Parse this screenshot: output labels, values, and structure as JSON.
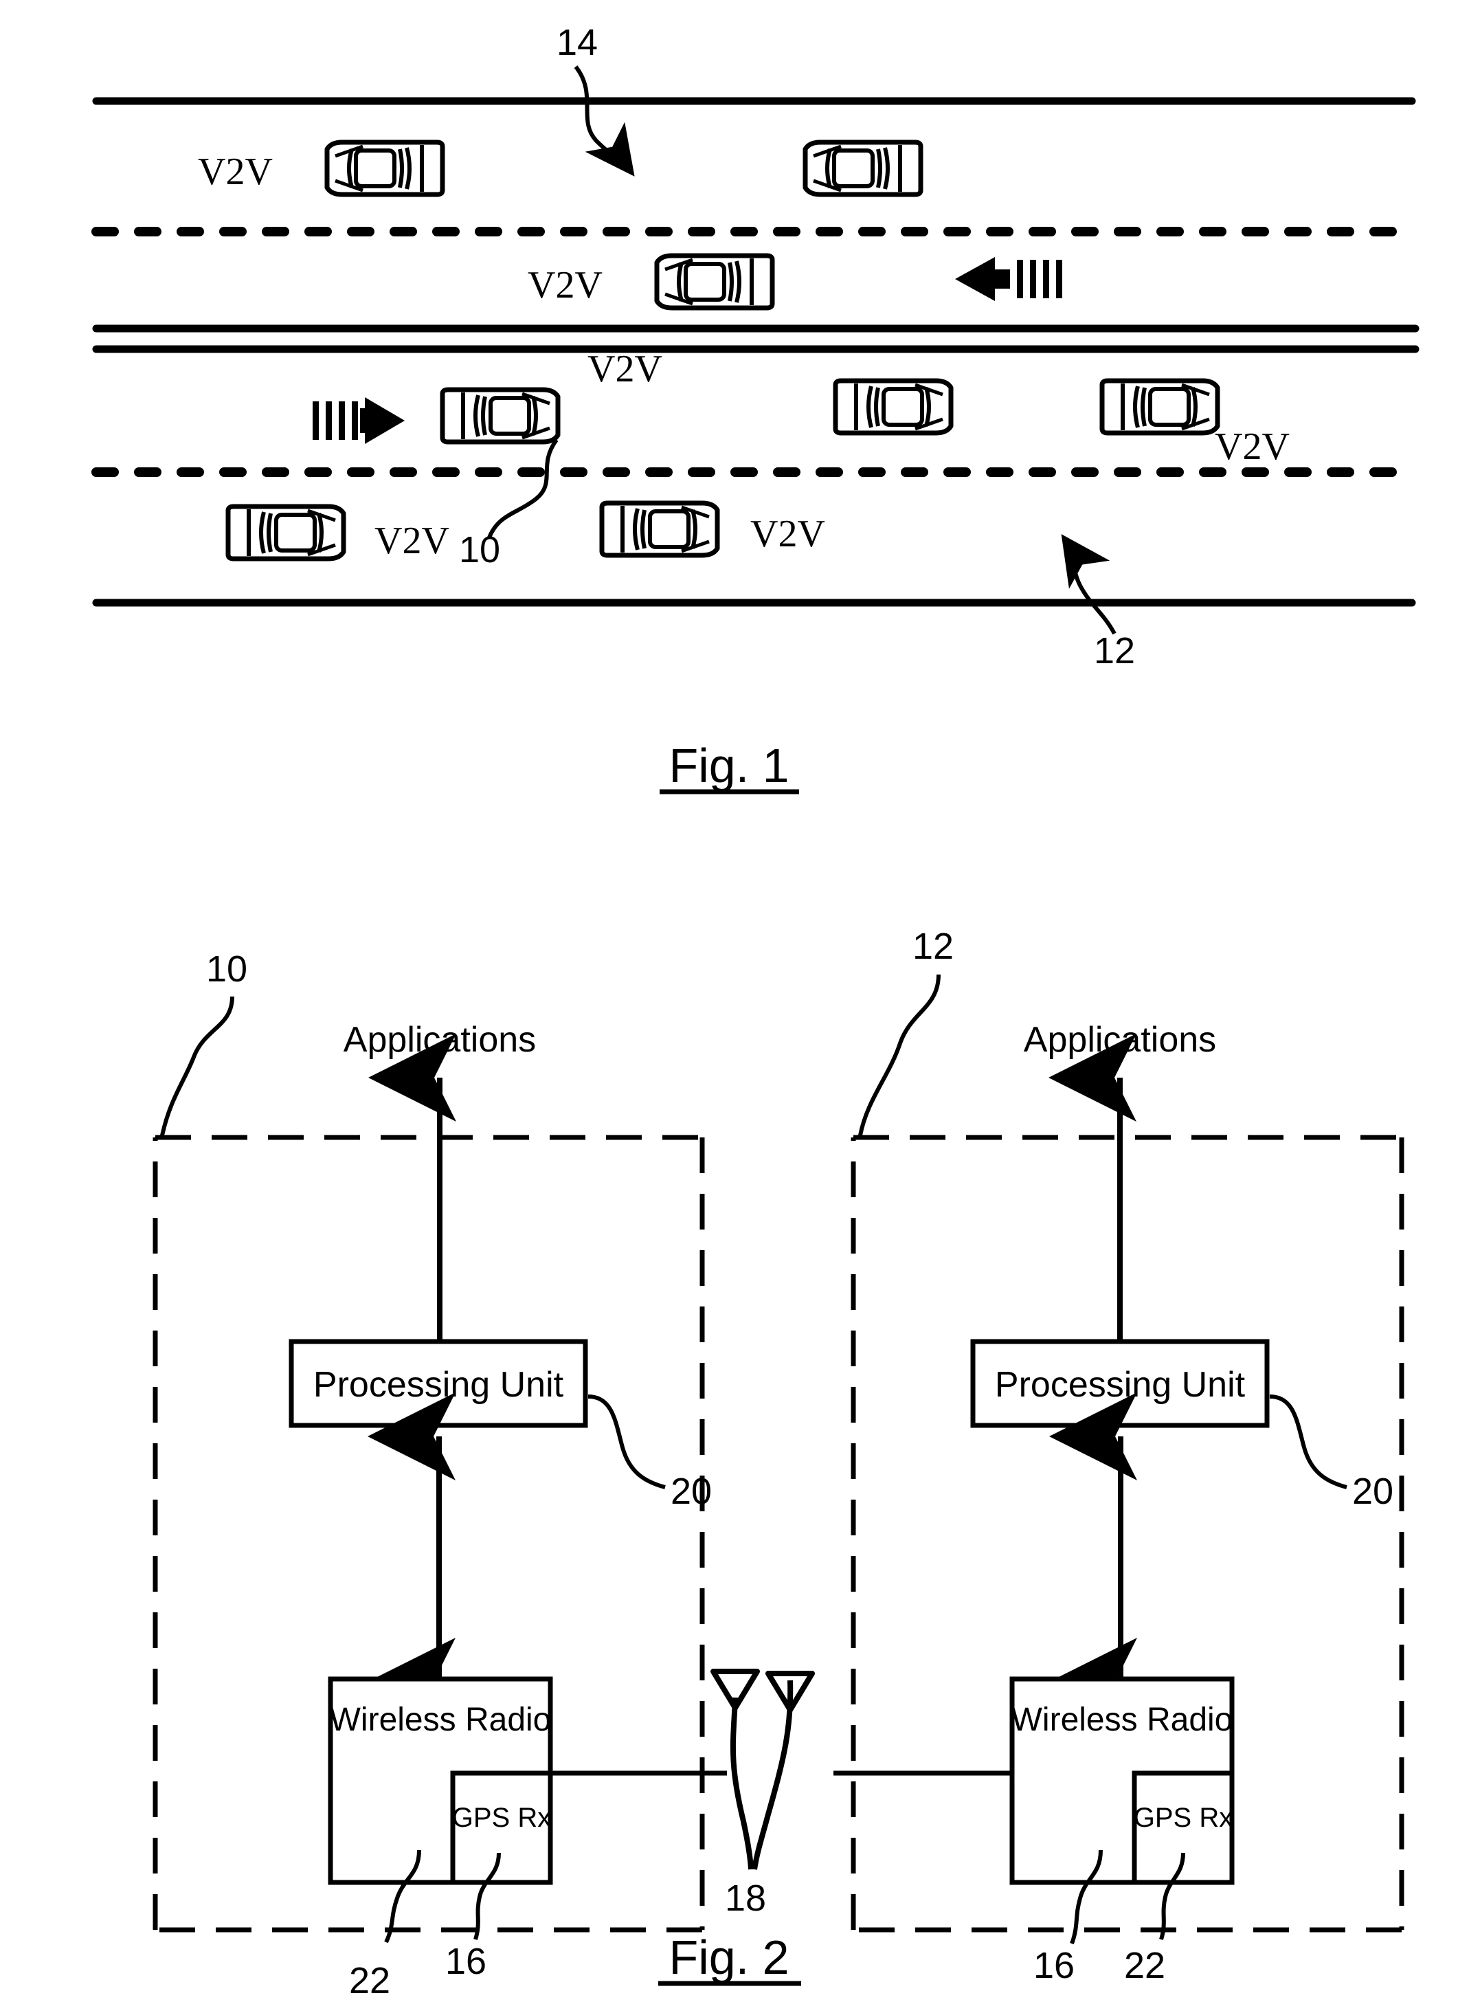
{
  "document": {
    "type": "patent-drawing-sheet",
    "figures": [
      "Fig. 1",
      "Fig. 2"
    ]
  },
  "figure1": {
    "caption": "Fig. 1",
    "vehicle_label": "V2V",
    "reference_numerals": {
      "roadway_upper": "14",
      "roadway_lower": "12",
      "host_vehicle": "10"
    },
    "v2v_labels": [
      "V2V",
      "V2V",
      "V2V",
      "V2V",
      "V2V",
      "V2V",
      "V2V"
    ],
    "direction_arrows": [
      {
        "name": "leftward-traffic-arrow",
        "direction": "left"
      },
      {
        "name": "rightward-traffic-arrow",
        "direction": "right"
      }
    ],
    "lanes": [
      {
        "name": "upper-outer-lane",
        "divider": "solid-edge"
      },
      {
        "name": "upper-inner-lane",
        "divider": "dashed-lane-line"
      },
      {
        "name": "center-median",
        "divider": "double-solid-line"
      },
      {
        "name": "lower-inner-lane",
        "divider": "dashed-lane-line"
      },
      {
        "name": "lower-outer-lane",
        "divider": "solid-edge"
      }
    ],
    "vehicles": [
      {
        "id": "v1",
        "lane": "upper-outer",
        "equipped": true,
        "label_side": "left"
      },
      {
        "id": "v2",
        "lane": "upper-outer",
        "equipped": false,
        "label_side": "none"
      },
      {
        "id": "v3",
        "lane": "upper-inner",
        "equipped": true,
        "label_side": "left"
      },
      {
        "id": "v4",
        "lane": "lower-inner",
        "equipped": true,
        "label_side": "right",
        "numeral": "10"
      },
      {
        "id": "v5",
        "lane": "lower-inner",
        "equipped": false,
        "label_side": "none"
      },
      {
        "id": "v6",
        "lane": "lower-inner",
        "equipped": true,
        "label_side": "below-right"
      },
      {
        "id": "v7",
        "lane": "lower-outer",
        "equipped": true,
        "label_side": "right"
      },
      {
        "id": "v8",
        "lane": "lower-outer",
        "equipped": true,
        "label_side": "right"
      }
    ]
  },
  "figure2": {
    "caption": "Fig. 2",
    "left_unit": {
      "numeral": "10",
      "applications_label": "Applications",
      "processing_unit_label": "Processing Unit",
      "processing_unit_numeral": "20",
      "wireless_radio_label": "Wireless Radio",
      "wireless_radio_numeral": "22",
      "gps_rx_label": "GPS Rx",
      "gps_rx_numeral": "16"
    },
    "right_unit": {
      "numeral": "12",
      "applications_label": "Applications",
      "processing_unit_label": "Processing Unit",
      "processing_unit_numeral": "20",
      "wireless_radio_label": "Wireless Radio",
      "wireless_radio_numeral": "16",
      "gps_rx_label": "GPS Rx",
      "gps_rx_numeral": "22"
    },
    "antenna": {
      "numeral": "18",
      "count": 2
    }
  },
  "colors": {
    "ink": "#000000",
    "paper": "#ffffff"
  }
}
